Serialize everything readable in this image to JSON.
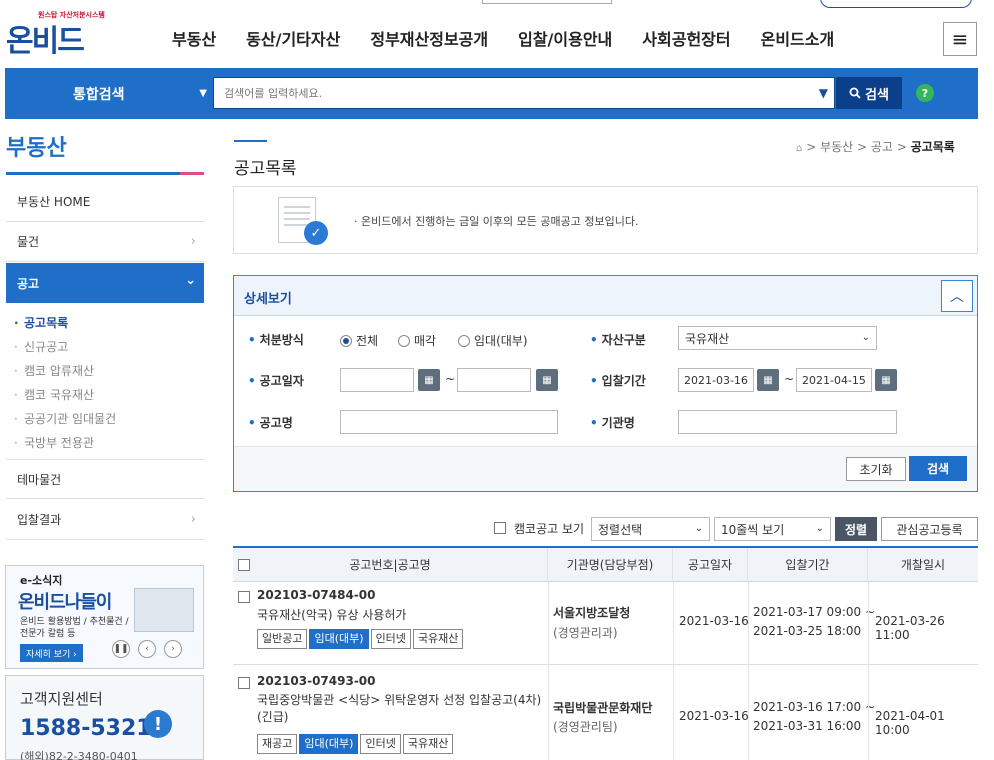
{
  "header": {
    "logo_tagline": "원스탑 자산처분시스템",
    "logo_text": "온비드",
    "nav": [
      "부동산",
      "동산/기타자산",
      "정부재산정보공개",
      "입찰/이용안내",
      "사회공헌장터",
      "온비드소개"
    ],
    "menu_icon": "hamburger-icon"
  },
  "search": {
    "scope": "통합검색",
    "placeholder": "검색어를 입력하세요.",
    "button": "검색",
    "help": "?"
  },
  "sidebar": {
    "title": "부동산",
    "items": [
      {
        "label": "부동산 HOME"
      },
      {
        "label": "물건"
      },
      {
        "label": "공고"
      },
      {
        "label": "테마물건"
      },
      {
        "label": "입찰결과"
      }
    ],
    "sub_items": [
      "공고목록",
      "신규공고",
      "캠코 압류재산",
      "캠코 국유재산",
      "공공기관 임대물건",
      "국방부 전용관"
    ],
    "banner1": {
      "t1": "e-소식지",
      "t2": "온비드나들이",
      "t3": "온비드 활용방법 / 추천물건 / 전문가 칼럼 등",
      "more": "자세히 보기 ›"
    },
    "banner2": {
      "title": "고객지원센터",
      "phone": "1588-5321",
      "overseas": "(해외)82-2-3480-0401"
    }
  },
  "main": {
    "page_title": "공고목록",
    "breadcrumb": [
      "부동산",
      "공고",
      "공고목록"
    ],
    "info_text": "· 온비드에서 진행하는 금일 이후의 모든 공매공고 정보입니다.",
    "detail": {
      "title": "상세보기",
      "disposal_label": "처분방식",
      "disposal_options": [
        "전체",
        "매각",
        "임대(대부)"
      ],
      "asset_label": "자산구분",
      "asset_value": "국유재산",
      "notice_date_label": "공고일자",
      "bid_period_label": "입찰기간",
      "bid_from": "2021-03-16",
      "bid_to": "2021-04-15",
      "notice_name_label": "공고명",
      "org_name_label": "기관명",
      "reset_btn": "초기화",
      "search_btn": "검색"
    },
    "toolbar": {
      "kamco_only": "캠코공고 보기",
      "sort_select": "정렬선택",
      "per_page": "10줄씩 보기",
      "sort_btn": "정렬",
      "fav_btn": "관심공고등록"
    },
    "table": {
      "headers": [
        "공고번호|공고명",
        "기관명(담당부점)",
        "공고일자",
        "입찰기간",
        "개찰일시"
      ],
      "rows": [
        {
          "number": "202103-07484-00",
          "name": "국유재산(악국) 유상 사용허가",
          "tags": [
            "일반공고",
            "임대(대부)",
            "인터넷",
            "국유재산"
          ],
          "org": "서울지방조달청",
          "dept": "(경영관리과)",
          "notice_date": "2021-03-16",
          "bid_start": "2021-03-17 09:00 ~",
          "bid_end": "2021-03-25 18:00",
          "open_date": "2021-03-26 11:00"
        },
        {
          "number": "202103-07493-00",
          "name": "국립중앙박물관 <식당> 위탁운영자 선정 입찰공고(4차)(긴급)",
          "tags": [
            "재공고",
            "임대(대부)",
            "인터넷",
            "국유재산"
          ],
          "org": "국립박물관문화재단",
          "dept": "(경영관리팀)",
          "notice_date": "2021-03-16",
          "bid_start": "2021-03-16 17:00 ~",
          "bid_end": "2021-03-31 16:00",
          "open_date": "2021-04-01 10:00"
        }
      ]
    }
  }
}
